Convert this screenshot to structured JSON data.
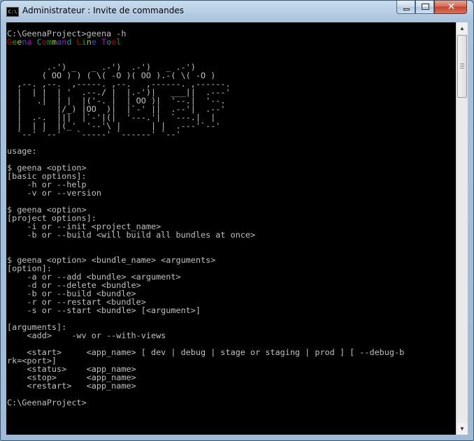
{
  "window": {
    "title": "Administrateur : Invite de commandes",
    "icon_label": "C:\\",
    "close_glyph": "✕"
  },
  "console": {
    "lines": [
      {
        "text": "C:\\GeenaProject>geena -h"
      },
      {
        "segments": [
          {
            "text": "G",
            "color": "#c00000"
          },
          {
            "text": "e",
            "color": "#00a000"
          },
          {
            "text": "e",
            "color": "#c0c000"
          },
          {
            "text": "n",
            "color": "#2f4fe0"
          },
          {
            "text": "a",
            "color": "#c000c0"
          },
          {
            "text": " ",
            "color": "#c0c0c0"
          },
          {
            "text": "C",
            "color": "#00a0a0"
          },
          {
            "text": "o",
            "color": "#c00000"
          },
          {
            "text": "m",
            "color": "#00a000"
          },
          {
            "text": "m",
            "color": "#c0c000"
          },
          {
            "text": "a",
            "color": "#2f4fe0"
          },
          {
            "text": "n",
            "color": "#c000c0"
          },
          {
            "text": "d",
            "color": "#00a0a0"
          },
          {
            "text": " ",
            "color": "#c0c0c0"
          },
          {
            "text": "L",
            "color": "#c00000"
          },
          {
            "text": "i",
            "color": "#00a000"
          },
          {
            "text": "n",
            "color": "#c0c000"
          },
          {
            "text": "e",
            "color": "#2f4fe0"
          },
          {
            "text": " ",
            "color": "#c0c0c0"
          },
          {
            "text": "T",
            "color": "#c000c0"
          },
          {
            "text": "o",
            "color": "#00a0a0"
          },
          {
            "text": "o",
            "color": "#c00000"
          },
          {
            "text": "l",
            "color": "#00a000"
          }
        ]
      },
      {
        "text": ""
      },
      {
        "text": ""
      },
      {
        "text": "        .-') _   _ .-')  .-')   _ .-')"
      },
      {
        "text": "       ( OO ) ) ( \\( -O )( OO ).-( \\( -O )"
      },
      {
        "text": "  ,--. ,--.  ,-----. ,--.   ,------. ,------."
      },
      {
        "text": "  |  | |  | '  .--./ |  |.-')|   ___||  .---'"
      },
      {
        "text": "  |   .|  | |  |('-. |  | OO )|  '--.|  '--."
      },
      {
        "text": "  |       |/_) |OO  )|  |`-' ||  .--'|  .--'"
      },
      {
        "text": "  |  .-.  |||  |`-'|(|  '---.'|  `---.|  |"
      },
      {
        "text": "  |  | |  |(_'  '--'\\ |      | |  .---'`--'"
      },
      {
        "text": "  `--' `--'   `-----' `------' `--'"
      },
      {
        "text": ""
      },
      {
        "text": "usage:"
      },
      {
        "text": ""
      },
      {
        "text": "$ geena <option>"
      },
      {
        "text": "[basic options]:"
      },
      {
        "text": "    -h or --help"
      },
      {
        "text": "    -v or --version"
      },
      {
        "text": ""
      },
      {
        "text": "$ geena <option>"
      },
      {
        "text": "[project options]:"
      },
      {
        "text": "    -i or --init <project_name>"
      },
      {
        "text": "    -b or --build <will build all bundles at once>"
      },
      {
        "text": ""
      },
      {
        "text": ""
      },
      {
        "text": "$ geena <option> <bundle_name> <arguments>"
      },
      {
        "text": "[option]:"
      },
      {
        "text": "    -a or --add <bundle> <argument>"
      },
      {
        "text": "    -d or --delete <bundle>"
      },
      {
        "text": "    -b or --build <bundle>"
      },
      {
        "text": "    -r or --restart <bundle>"
      },
      {
        "text": "    -s or --start <bundle> [<argument>]"
      },
      {
        "text": ""
      },
      {
        "text": "[arguments]:"
      },
      {
        "text": "    <add>    -wv or --with-views"
      },
      {
        "text": ""
      },
      {
        "text": "    <start>     <app_name> [ dev | debug | stage or staging | prod ] [ --debug-b"
      },
      {
        "text": "rk=<port>]"
      },
      {
        "text": "    <status>    <app_name>"
      },
      {
        "text": "    <stop>      <app_name>"
      },
      {
        "text": "    <restart>   <app_name>"
      },
      {
        "text": ""
      },
      {
        "text": "C:\\GeenaProject>"
      }
    ]
  },
  "scrollbar": {
    "up_glyph": "▲",
    "down_glyph": "▼",
    "position": 0.0
  }
}
